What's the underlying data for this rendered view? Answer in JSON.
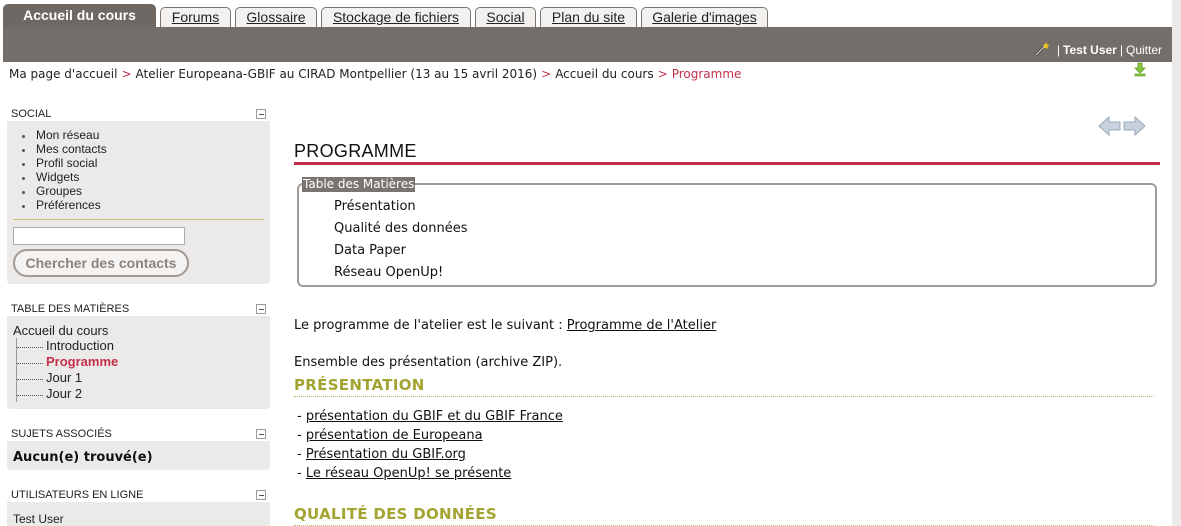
{
  "tabs": [
    {
      "label": "Accueil du cours",
      "active": true
    },
    {
      "label": "Forums",
      "active": false
    },
    {
      "label": "Glossaire",
      "active": false
    },
    {
      "label": "Stockage de fichiers",
      "active": false
    },
    {
      "label": "Social",
      "active": false
    },
    {
      "label": "Plan du site",
      "active": false
    },
    {
      "label": "Galerie d'images",
      "active": false
    }
  ],
  "userbar": {
    "separator": "|",
    "user": "Test User",
    "logout": "Quitter"
  },
  "breadcrumb": {
    "items": [
      "Ma page d'accueil",
      "Atelier Europeana-GBIF au CIRAD Montpellier (13 au 15 avril 2016)",
      "Accueil du cours"
    ],
    "current": "Programme",
    "arrow": ">"
  },
  "sidebar": {
    "social": {
      "title": "SOCIAL",
      "items": [
        "Mon réseau",
        "Mes contacts",
        "Profil social",
        "Widgets",
        "Groupes",
        "Préférences"
      ],
      "search_value": "",
      "search_button": "Chercher des contacts"
    },
    "toc": {
      "title": "TABLE DES MATIÈRES",
      "root": "Accueil du cours",
      "items": [
        "Introduction",
        "Programme",
        "Jour 1",
        "Jour 2"
      ]
    },
    "related": {
      "title": "SUJETS ASSOCIÉS",
      "text": "Aucun(e) trouvé(e)"
    },
    "online": {
      "title": "UTILISATEURS EN LIGNE",
      "users": [
        "Test User"
      ]
    }
  },
  "main": {
    "title": "PROGRAMME",
    "toc_legend": "Table des Matières",
    "toc_items": [
      "Présentation",
      "Qualité des données",
      "Data Paper",
      "Réseau OpenUp!"
    ],
    "intro_text": "Le programme de l'atelier est le suivant :",
    "intro_link": "Programme de l'Atelier",
    "archive_text": "Ensemble des présentation (archive ZIP).",
    "section1": "PRÉSENTATION",
    "links_prefix": "-",
    "links": [
      "présentation du GBIF et du GBIF France",
      "présentation de Europeana",
      "Présentation du GBIF.org",
      "Le réseau OpenUp! se présente"
    ],
    "section2": "QUALITÉ DES DONNÉES"
  },
  "colors": {
    "accent": "#c4304a",
    "header": "#746e6a",
    "section": "#a3a331",
    "sidebar_bg": "#eceae8"
  }
}
